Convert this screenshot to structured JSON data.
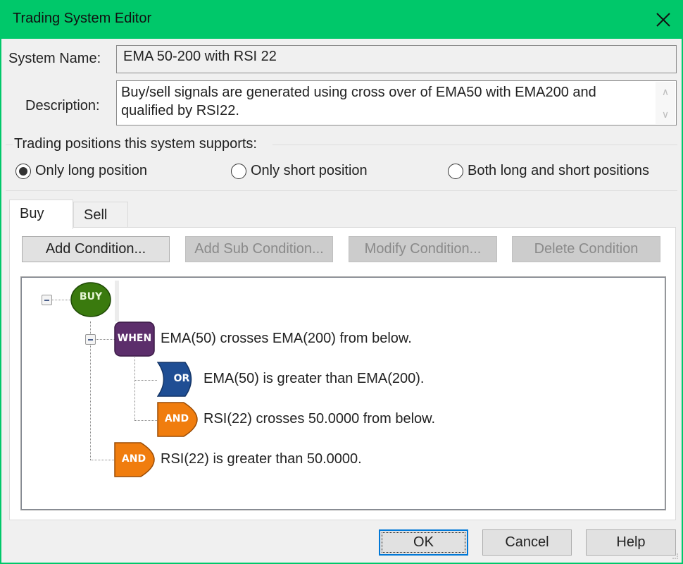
{
  "window": {
    "title": "Trading System Editor",
    "close_icon": "close-icon"
  },
  "form": {
    "system_name_label": "System Name:",
    "system_name_value": "EMA 50-200 with RSI 22",
    "description_label": "Description:",
    "description_value": "Buy/sell signals are generated using cross over of EMA50 with EMA200 and qualified by RSI22."
  },
  "positions": {
    "group_label": "Trading positions this system supports:",
    "options": [
      {
        "label": "Only long position",
        "selected": true
      },
      {
        "label": "Only short position",
        "selected": false
      },
      {
        "label": "Both long and short positions",
        "selected": false
      }
    ]
  },
  "tabs": [
    {
      "label": "Buy",
      "active": true
    },
    {
      "label": "Sell",
      "active": false
    }
  ],
  "toolbar": {
    "add_condition": "Add Condition...",
    "add_sub_condition": "Add Sub Condition...",
    "modify_condition": "Modify Condition...",
    "delete_condition": "Delete Condition"
  },
  "tree": {
    "root": {
      "badge": "BUY",
      "color": "#3a7a0e",
      "expanded": true
    },
    "nodes": [
      {
        "badge": "WHEN",
        "color": "#5c2e6b",
        "text": "EMA(50) crosses EMA(200) from below.",
        "expanded": true
      },
      {
        "badge": "OR",
        "color": "#1f4e94",
        "text": "EMA(50) is greater than EMA(200)."
      },
      {
        "badge": "AND",
        "color": "#f07d0e",
        "text": "RSI(22) crosses 50.0000 from below."
      },
      {
        "badge": "AND",
        "color": "#f07d0e",
        "text": "RSI(22) is greater than 50.0000."
      }
    ]
  },
  "footer": {
    "ok": "OK",
    "cancel": "Cancel",
    "help": "Help"
  },
  "colors": {
    "titlebar": "#00c86a",
    "focus": "#0078d7"
  }
}
